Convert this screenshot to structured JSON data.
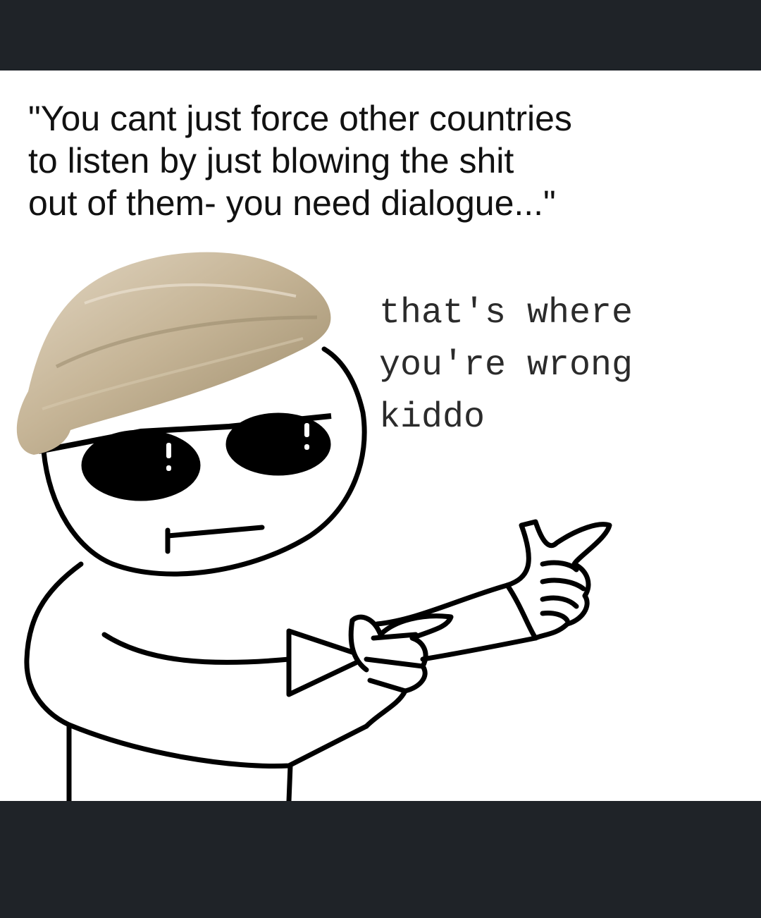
{
  "meme": {
    "caption_lines": [
      "\"You cant just force other countries",
      "to listen by just blowing the shit",
      "out of them- you need dialogue...\""
    ],
    "speech_lines": [
      "that's where",
      "you're wrong",
      "kiddo"
    ],
    "character": {
      "description_icon": "stick-figure-sunglasses-pointing",
      "hair_color": "#c9b79a",
      "glasses_color": "#000000"
    },
    "colors": {
      "frame": "#1f2328",
      "panel": "#ffffff",
      "ink": "#000000"
    }
  }
}
